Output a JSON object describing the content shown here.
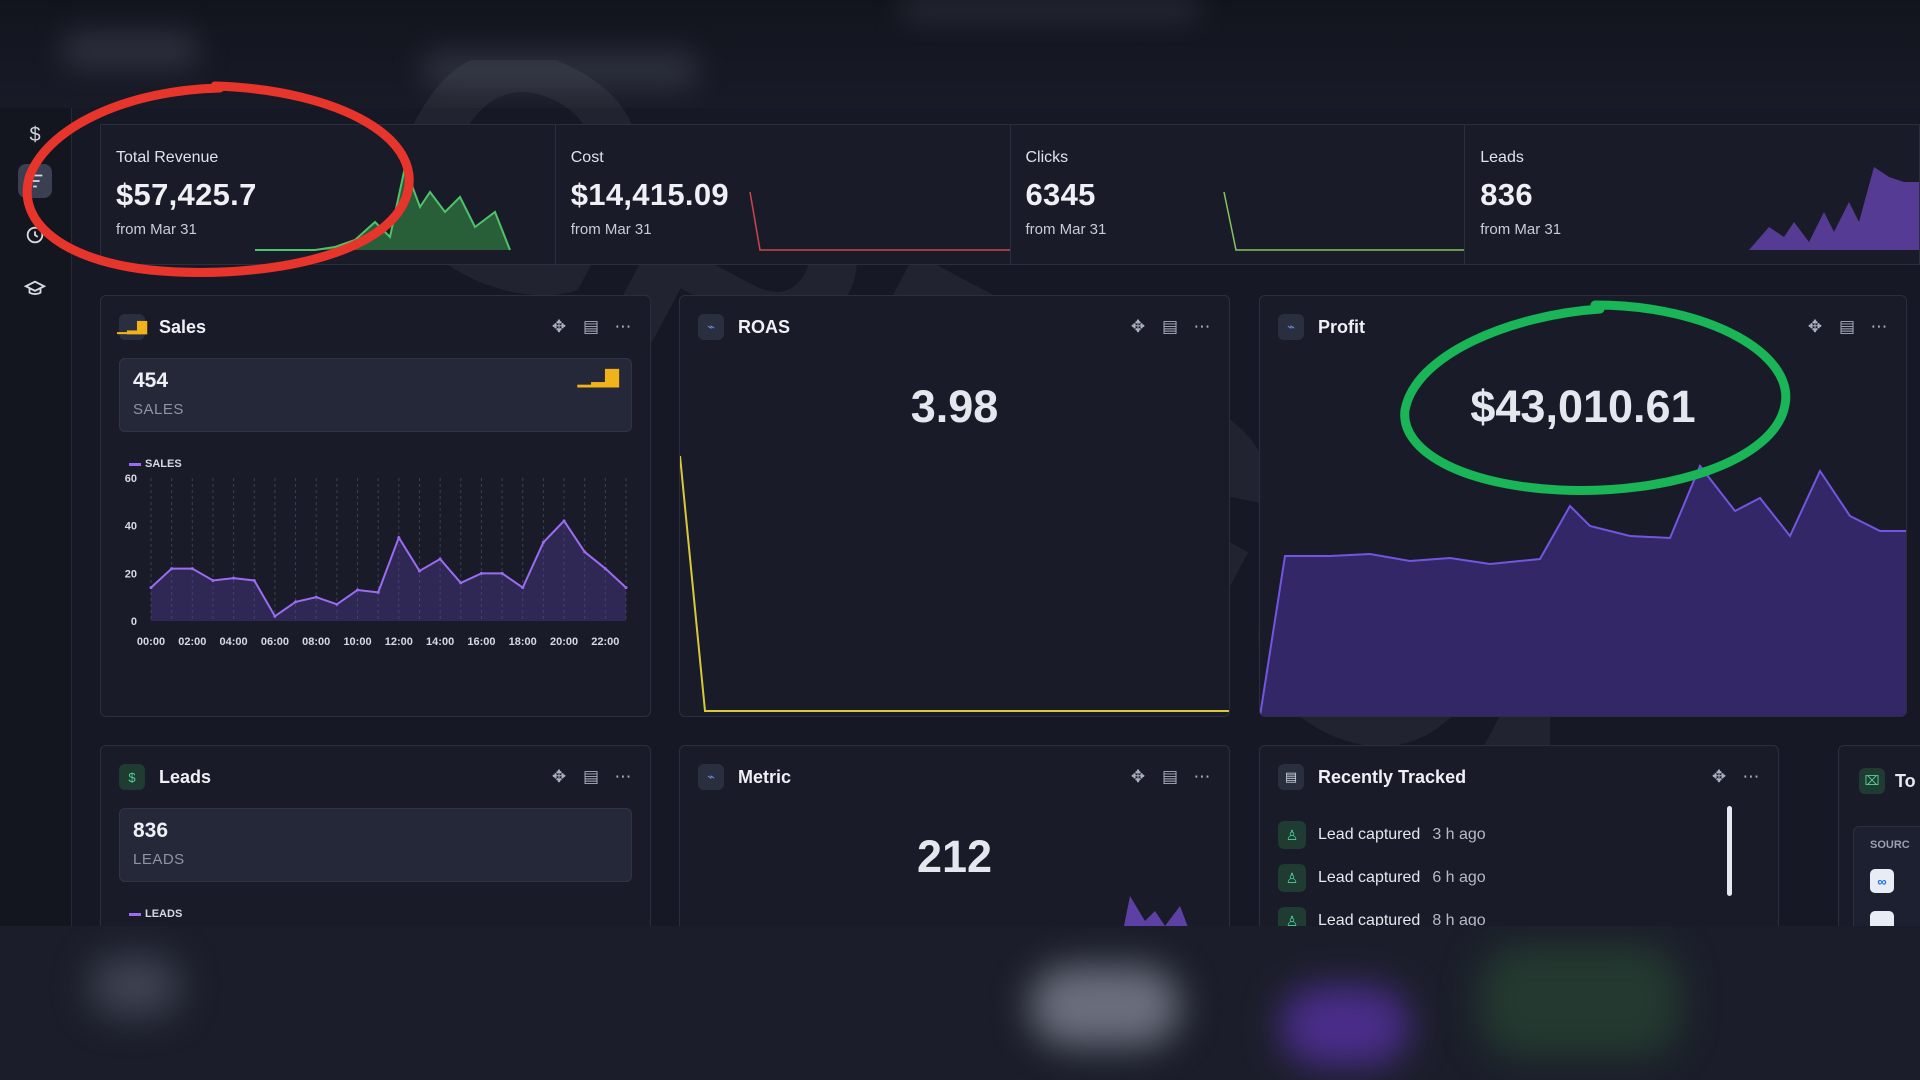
{
  "stats": [
    {
      "label": "Total Revenue",
      "value": "$57,425.7",
      "sub": "from Mar 31",
      "color": "#3fae5a"
    },
    {
      "label": "Cost",
      "value": "$14,415.09",
      "sub": "from Mar 31",
      "color": "#d9544f"
    },
    {
      "label": "Clicks",
      "value": "6345",
      "sub": "from Mar 31",
      "color": "#8fcf5a"
    },
    {
      "label": "Leads",
      "value": "836",
      "sub": "from Mar 31",
      "color": "#8e5ce6"
    }
  ],
  "sales_card": {
    "title": "Sales",
    "metric_value": "454",
    "metric_unit": "SALES",
    "legend": "SALES"
  },
  "roas_card": {
    "title": "ROAS",
    "value": "3.98"
  },
  "profit_card": {
    "title": "Profit",
    "value": "$43,010.61"
  },
  "leads_card": {
    "title": "Leads",
    "metric_value": "836",
    "metric_unit": "LEADS",
    "legend": "LEADS"
  },
  "metric_card": {
    "title": "Metric",
    "value": "212"
  },
  "tracked_card": {
    "title": "Recently Tracked",
    "rows": [
      {
        "text": "Lead captured",
        "time": "3 h ago"
      },
      {
        "text": "Lead captured",
        "time": "6 h ago"
      },
      {
        "text": "Lead captured",
        "time": "8 h ago"
      }
    ]
  },
  "partial_card": {
    "title": "To",
    "column": "SOURC"
  },
  "watermark": "GREGORY",
  "chart_data": {
    "type": "line",
    "legend": [
      "SALES"
    ],
    "categories": [
      "00:00",
      "01:00",
      "02:00",
      "03:00",
      "04:00",
      "05:00",
      "06:00",
      "07:00",
      "08:00",
      "09:00",
      "10:00",
      "11:00",
      "12:00",
      "13:00",
      "14:00",
      "15:00",
      "16:00",
      "17:00",
      "18:00",
      "19:00",
      "20:00",
      "21:00",
      "22:00",
      "23:00"
    ],
    "tick_labels": [
      "00:00",
      "02:00",
      "04:00",
      "06:00",
      "08:00",
      "10:00",
      "12:00",
      "14:00",
      "16:00",
      "18:00",
      "20:00",
      "22:00"
    ],
    "series": [
      {
        "name": "SALES",
        "values": [
          14,
          22,
          22,
          17,
          18,
          17,
          2,
          8,
          10,
          7,
          13,
          12,
          35,
          21,
          26,
          16,
          20,
          20,
          14,
          33,
          42,
          29,
          22,
          14
        ]
      }
    ],
    "ylim": [
      0,
      60
    ],
    "yticks": [
      0,
      20,
      40,
      60
    ],
    "grid": true
  }
}
